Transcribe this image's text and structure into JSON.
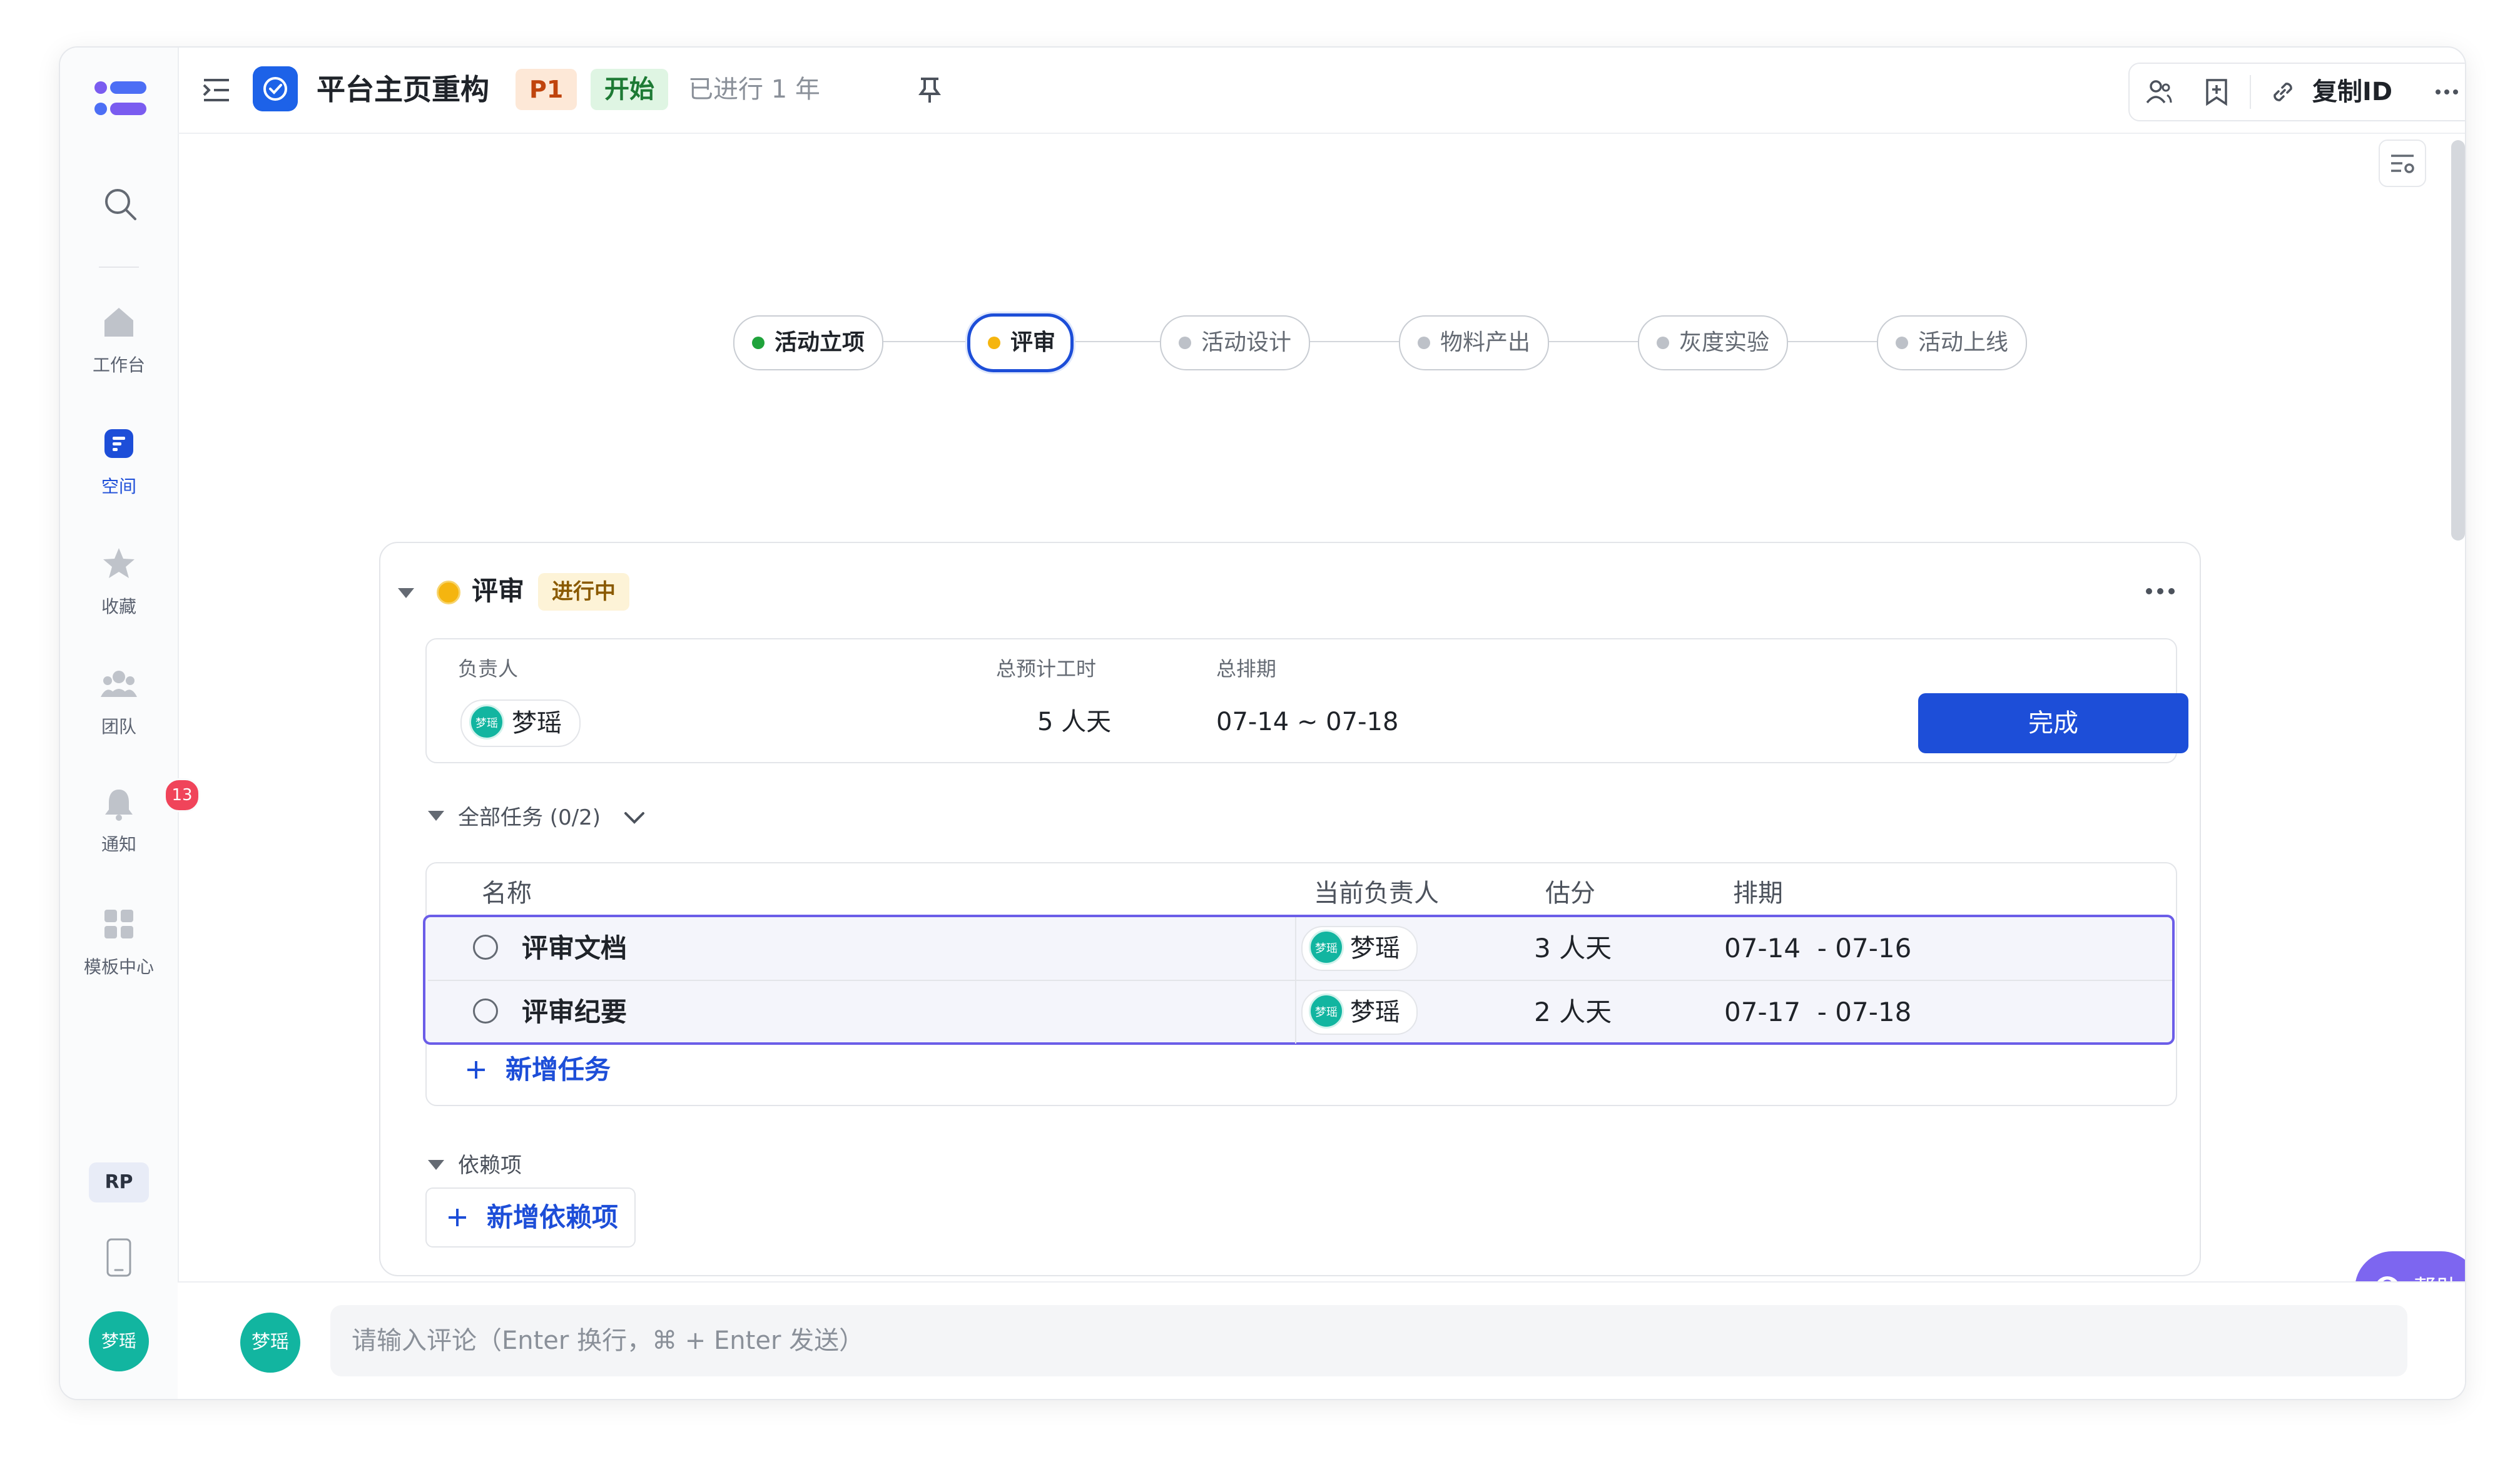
{
  "sidebar": {
    "nav": [
      {
        "label": "工作台",
        "icon": "home-icon"
      },
      {
        "label": "空间",
        "icon": "space-icon"
      },
      {
        "label": "收藏",
        "icon": "star-icon"
      },
      {
        "label": "团队",
        "icon": "team-icon"
      },
      {
        "label": "通知",
        "icon": "bell-icon",
        "badge": "13"
      },
      {
        "label": "模板中心",
        "icon": "template-icon"
      }
    ],
    "user_initials": "RP",
    "avatar_name": "梦瑶"
  },
  "header": {
    "title": "平台主页重构",
    "priority": "P1",
    "status": "开始",
    "elapsed": "已进行 1 年",
    "copy_id": "复制ID"
  },
  "stages": [
    {
      "label": "活动立项",
      "state": "done"
    },
    {
      "label": "评审",
      "state": "current"
    },
    {
      "label": "活动设计",
      "state": "pending"
    },
    {
      "label": "物料产出",
      "state": "pending"
    },
    {
      "label": "灰度实验",
      "state": "pending"
    },
    {
      "label": "活动上线",
      "state": "pending"
    }
  ],
  "stage_card": {
    "title": "评审",
    "status": "进行中",
    "owner_label": "负责人",
    "owner": "梦瑶",
    "owner_avatar": "梦瑶",
    "hours_label": "总预计工时",
    "hours": "5 人天",
    "schedule_label": "总排期",
    "schedule": "07-14 ~ 07-18",
    "complete_button": "完成",
    "tasks_label": "全部任务 (0/2)",
    "columns": [
      "名称",
      "当前负责人",
      "估分",
      "排期"
    ],
    "tasks": [
      {
        "name": "评审文档",
        "assignee": "梦瑶",
        "avatar": "梦瑶",
        "estimate": "3 人天",
        "schedule": "07-14  - 07-16"
      },
      {
        "name": "评审纪要",
        "assignee": "梦瑶",
        "avatar": "梦瑶",
        "estimate": "2 人天",
        "schedule": "07-17  - 07-18"
      }
    ],
    "add_task": "新增任务",
    "deps_label": "依赖项",
    "add_dep": "新增依赖项"
  },
  "help": "帮助",
  "comment": {
    "avatar": "梦瑶",
    "placeholder": "请输入评论（Enter 换行，⌘ + Enter 发送）"
  },
  "colors": {
    "accent": "#1d4ed8",
    "done_dot": "#1fa33b",
    "current_dot": "#f5b50f",
    "badge": "#f0445a",
    "help": "#7d66f0"
  }
}
